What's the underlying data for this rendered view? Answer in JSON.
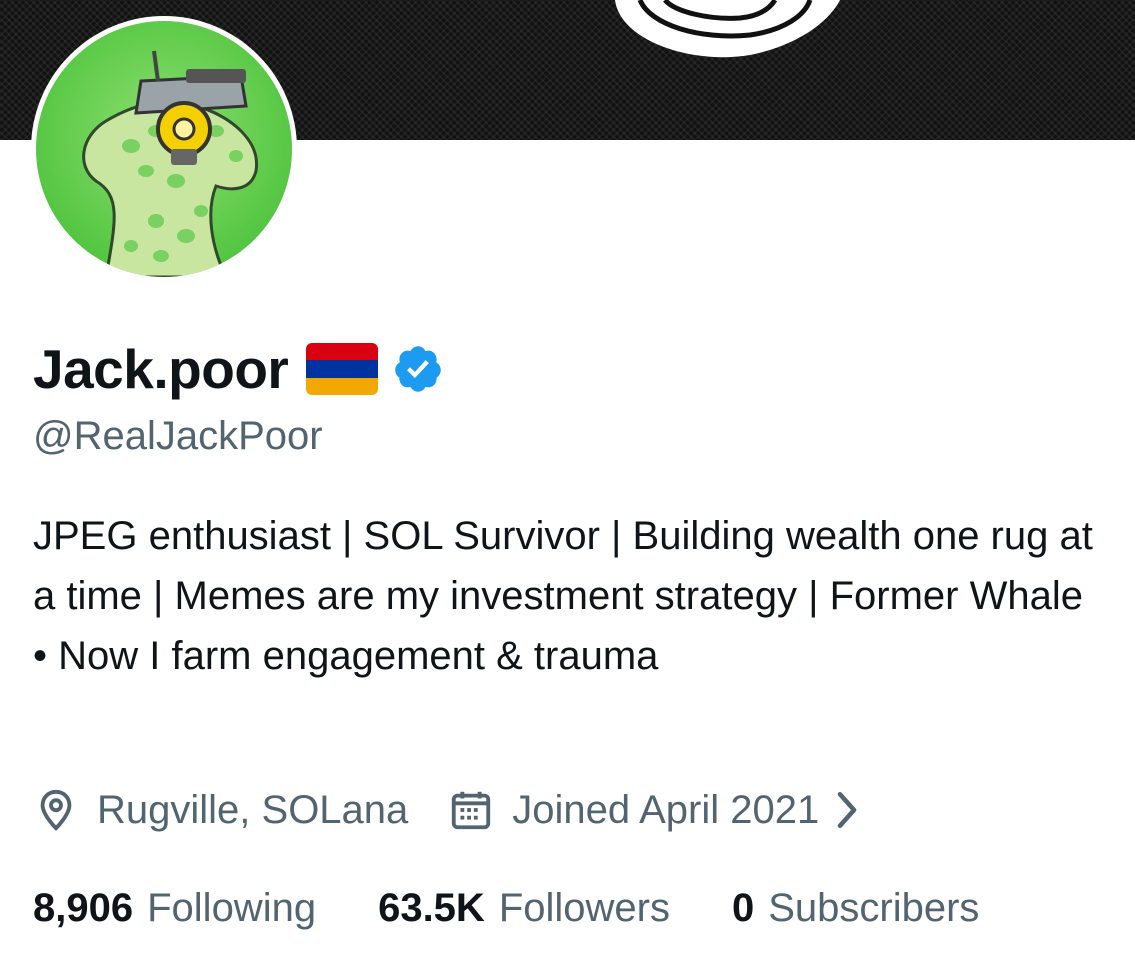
{
  "profile": {
    "display_name": "Jack.poor",
    "handle": "@RealJackPoor",
    "flag_colors": [
      "#d90012",
      "#0033a0",
      "#f2a800"
    ],
    "verified_color": "#1d9bf0",
    "bio": "JPEG enthusiast | SOL Survivor | Building wealth one rug at a time | Memes are my investment strategy | Former Whale • Now I farm engagement & trauma",
    "location": "Rugville, SOLana",
    "joined": "Joined April 2021"
  },
  "stats": {
    "following_count": "8,906",
    "following_label": "Following",
    "followers_count": "63.5K",
    "followers_label": "Followers",
    "subscribers_count": "0",
    "subscribers_label": "Subscribers"
  },
  "icons": {
    "location": "location-pin-icon",
    "calendar": "calendar-icon",
    "chevron": "chevron-right-icon",
    "verified": "verified-badge-icon"
  }
}
